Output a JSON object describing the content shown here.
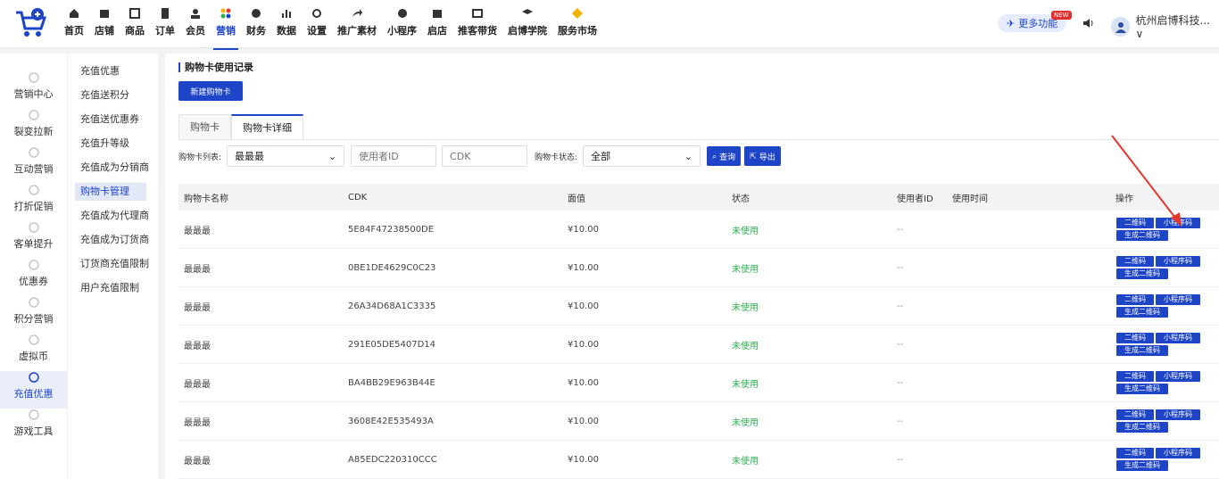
{
  "nav": {
    "items": [
      {
        "label": "首页",
        "icon": "home-icon"
      },
      {
        "label": "店铺",
        "icon": "store-icon"
      },
      {
        "label": "商品",
        "icon": "goods-icon"
      },
      {
        "label": "订单",
        "icon": "order-icon"
      },
      {
        "label": "会员",
        "icon": "member-icon"
      },
      {
        "label": "营销",
        "icon": "marketing-icon",
        "active": true
      },
      {
        "label": "财务",
        "icon": "finance-icon"
      },
      {
        "label": "数据",
        "icon": "data-icon"
      },
      {
        "label": "设置",
        "icon": "settings-icon"
      },
      {
        "label": "推广素材",
        "icon": "share-icon"
      },
      {
        "label": "小程序",
        "icon": "miniprogram-icon"
      },
      {
        "label": "启店",
        "icon": "shop-icon"
      },
      {
        "label": "推客带货",
        "icon": "promoter-icon"
      },
      {
        "label": "启博学院",
        "icon": "academy-icon"
      },
      {
        "label": "服务市场",
        "icon": "market-icon"
      }
    ],
    "more_label": "更多功能",
    "new_tag": "NEW",
    "user_name": "杭州启博科技... ∨",
    "accent": "#1e44c8"
  },
  "side1": {
    "items": [
      {
        "label": "营销中心"
      },
      {
        "label": "裂变拉新"
      },
      {
        "label": "互动营销"
      },
      {
        "label": "打折促销"
      },
      {
        "label": "客单提升"
      },
      {
        "label": "优惠券"
      },
      {
        "label": "积分营销"
      },
      {
        "label": "虚拟币"
      },
      {
        "label": "充值优惠",
        "active": true
      },
      {
        "label": "游戏工具"
      }
    ]
  },
  "side2": {
    "items": [
      {
        "label": "充值优惠"
      },
      {
        "label": "充值送积分"
      },
      {
        "label": "充值送优惠券"
      },
      {
        "label": "充值升等级"
      },
      {
        "label": "充值成为分销商"
      },
      {
        "label": "购物卡管理",
        "active": true
      },
      {
        "label": "充值成为代理商"
      },
      {
        "label": "充值成为订货商"
      },
      {
        "label": "订货商充值限制"
      },
      {
        "label": "用户充值限制"
      }
    ]
  },
  "main": {
    "title": "购物卡使用记录",
    "new_button": "新建购物卡",
    "tabs": [
      {
        "label": "购物卡"
      },
      {
        "label": "购物卡详细",
        "active": true
      }
    ],
    "filters": {
      "list_label": "购物卡列表:",
      "list_value": "最最最",
      "user_placeholder": "使用者ID",
      "cdk_placeholder": "CDK",
      "status_label": "购物卡状态:",
      "status_value": "全部",
      "search_button": "查询",
      "export_button": "导出"
    },
    "table": {
      "headers": {
        "name": "购物卡名称",
        "cdk": "CDK",
        "value": "面值",
        "status": "状态",
        "user": "使用者ID",
        "time": "使用时间",
        "ops": "操作"
      },
      "rows": [
        {
          "name": "最最最",
          "cdk": "5E84F47238500DE",
          "value": "¥10.00",
          "status": "未使用",
          "user": "--"
        },
        {
          "name": "最最最",
          "cdk": "0BE1DE4629C0C23",
          "value": "¥10.00",
          "status": "未使用",
          "user": "--"
        },
        {
          "name": "最最最",
          "cdk": "26A34D68A1C3335",
          "value": "¥10.00",
          "status": "未使用",
          "user": "--"
        },
        {
          "name": "最最最",
          "cdk": "291E05DE5407D14",
          "value": "¥10.00",
          "status": "未使用",
          "user": "--"
        },
        {
          "name": "最最最",
          "cdk": "BA4BB29E963B44E",
          "value": "¥10.00",
          "status": "未使用",
          "user": "--"
        },
        {
          "name": "最最最",
          "cdk": "3608E42E535493A",
          "value": "¥10.00",
          "status": "未使用",
          "user": "--"
        },
        {
          "name": "最最最",
          "cdk": "A85EDC220310CCC",
          "value": "¥10.00",
          "status": "未使用",
          "user": "--"
        }
      ],
      "op_labels": {
        "qr": "二维码",
        "mini_qr": "小程序码",
        "gen_qr": "生成二维码"
      }
    }
  }
}
